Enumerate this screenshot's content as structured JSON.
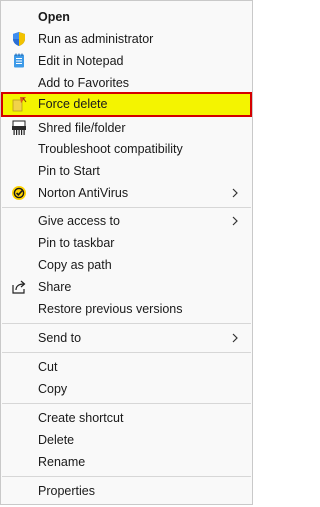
{
  "menu": {
    "items": [
      {
        "label": "Open",
        "icon": "none",
        "bold": true
      },
      {
        "label": "Run as administrator",
        "icon": "uac-shield-icon"
      },
      {
        "label": "Edit in Notepad",
        "icon": "notepad-icon"
      },
      {
        "label": "Add to Favorites",
        "icon": "none"
      },
      {
        "label": "Force delete",
        "icon": "force-delete-icon",
        "highlighted": true
      },
      {
        "label": "Shred file/folder",
        "icon": "shredder-icon"
      },
      {
        "label": "Troubleshoot compatibility",
        "icon": "none"
      },
      {
        "label": "Pin to Start",
        "icon": "none"
      },
      {
        "label": "Norton AntiVirus",
        "icon": "norton-check-icon",
        "submenu": true
      },
      {
        "label": "Give access to",
        "icon": "none",
        "submenu": true
      },
      {
        "label": "Pin to taskbar",
        "icon": "none"
      },
      {
        "label": "Copy as path",
        "icon": "none"
      },
      {
        "label": "Share",
        "icon": "share-icon"
      },
      {
        "label": "Restore previous versions",
        "icon": "none"
      },
      {
        "label": "Send to",
        "icon": "none",
        "submenu": true
      },
      {
        "label": "Cut",
        "icon": "none"
      },
      {
        "label": "Copy",
        "icon": "none"
      },
      {
        "label": "Create shortcut",
        "icon": "none"
      },
      {
        "label": "Delete",
        "icon": "none"
      },
      {
        "label": "Rename",
        "icon": "none"
      },
      {
        "label": "Properties",
        "icon": "none"
      }
    ]
  },
  "colors": {
    "highlight_fill": "#f4f400",
    "highlight_border": "#d40000",
    "menu_background": "#f9f9f9",
    "separator": "#d7d7d7",
    "text": "#1a1a1a"
  }
}
